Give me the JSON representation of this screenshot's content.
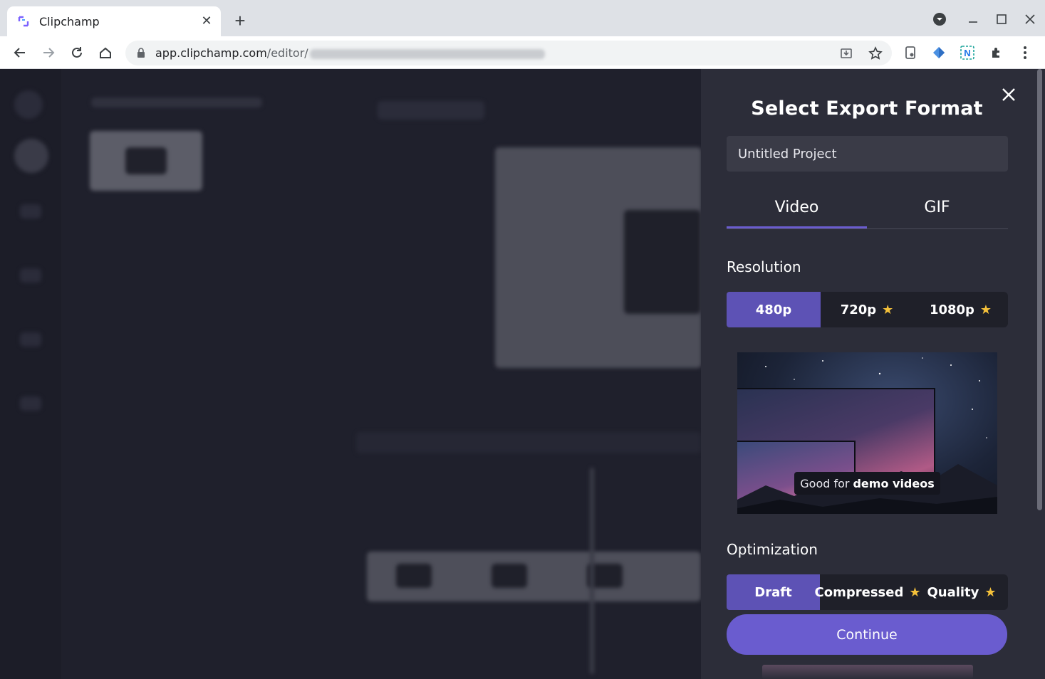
{
  "browser": {
    "tab_title": "Clipchamp",
    "url_host": "app.clipchamp.com",
    "url_path": "/editor/",
    "colors": {
      "tabbar": "#dee1e6",
      "toolbar": "#ffffff"
    }
  },
  "panel": {
    "title": "Select Export Format",
    "project_name": "Untitled Project",
    "tabs": [
      {
        "label": "Video",
        "active": true
      },
      {
        "label": "GIF",
        "active": false
      }
    ],
    "resolution": {
      "label": "Resolution",
      "options": [
        {
          "label": "480p",
          "selected": true,
          "premium": false
        },
        {
          "label": "720p",
          "selected": false,
          "premium": true
        },
        {
          "label": "1080p",
          "selected": false,
          "premium": true
        }
      ]
    },
    "preview": {
      "badge_prefix": "Good for",
      "badge_bold": "demo videos"
    },
    "optimization": {
      "label": "Optimization",
      "options": [
        {
          "label": "Draft",
          "selected": true,
          "premium": false
        },
        {
          "label": "Compressed",
          "selected": false,
          "premium": true
        },
        {
          "label": "Quality",
          "selected": false,
          "premium": true
        }
      ]
    },
    "continue_label": "Continue",
    "colors": {
      "accent": "#6a5ccf",
      "selected": "#5d52b5",
      "star": "#f5c13a",
      "panel_bg": "#2c2d39"
    }
  }
}
